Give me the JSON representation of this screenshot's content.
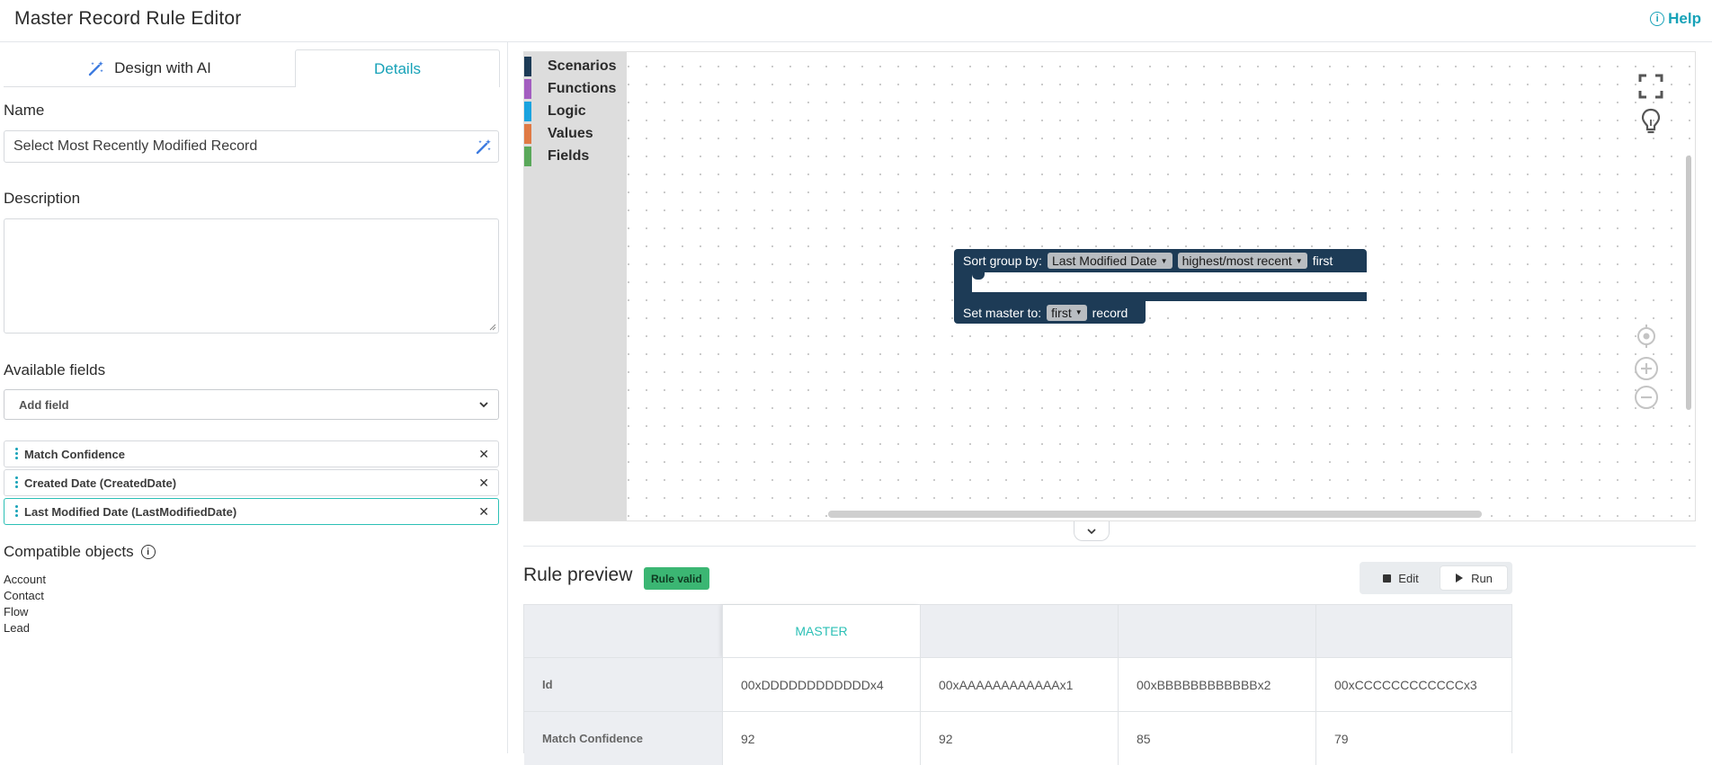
{
  "header": {
    "title": "Master Record Rule Editor",
    "help_label": "Help"
  },
  "left": {
    "tabs": [
      {
        "label": "Design with AI"
      },
      {
        "label": "Details"
      }
    ],
    "name_label": "Name",
    "name_value": "Select Most Recently Modified Record",
    "description_label": "Description",
    "description_value": "",
    "available_fields_label": "Available fields",
    "add_field_placeholder": "Add field",
    "fields": [
      {
        "label": "Match Confidence"
      },
      {
        "label": "Created Date (CreatedDate)"
      },
      {
        "label": "Last Modified Date (LastModifiedDate)"
      }
    ],
    "compatible_label": "Compatible objects",
    "compatible": [
      "Account",
      "Contact",
      "Flow",
      "Lead"
    ]
  },
  "workspace": {
    "categories": [
      {
        "label": "Scenarios",
        "color": "#1d3b56"
      },
      {
        "label": "Functions",
        "color": "#a35ec0"
      },
      {
        "label": "Logic",
        "color": "#1aa3df"
      },
      {
        "label": "Values",
        "color": "#e07a45"
      },
      {
        "label": "Fields",
        "color": "#5aa85a"
      }
    ],
    "sort_block": {
      "prefix": "Sort group by:",
      "field": "Last Modified Date",
      "order": "highest/most recent",
      "suffix": "first"
    },
    "master_block": {
      "prefix": "Set master to:",
      "choice": "first",
      "suffix": "record"
    }
  },
  "preview": {
    "title": "Rule preview",
    "badge": "Rule valid",
    "edit_label": "Edit",
    "run_label": "Run",
    "master_header": "MASTER",
    "rows": [
      {
        "label": "Id",
        "values": [
          "00xDDDDDDDDDDDDx4",
          "00xAAAAAAAAAAAAx1",
          "00xBBBBBBBBBBBBx2",
          "00xCCCCCCCCCCCCx3"
        ]
      },
      {
        "label": "Match Confidence",
        "values": [
          "92",
          "92",
          "85",
          "79"
        ]
      }
    ]
  },
  "colors": {
    "accent": "#17a2b8",
    "block": "#1d3b56",
    "valid": "#3bb673"
  }
}
